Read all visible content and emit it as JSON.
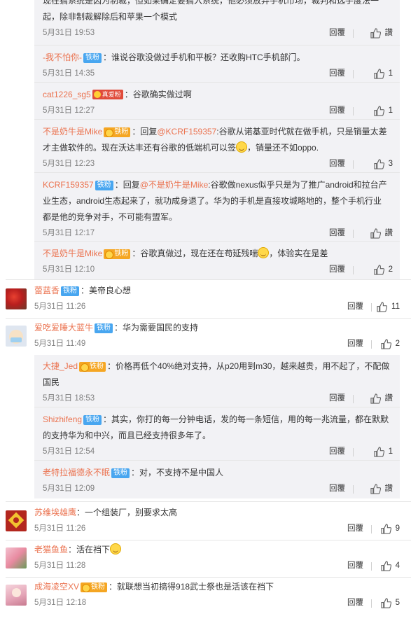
{
  "labels": {
    "reply": "回覆",
    "like": "讚"
  },
  "replies_a": [
    {
      "lines": [
        "现在搞系统是因为制裁，但如果确定要搞入系统，他必须放弃手机市场，裁判和选手度法一",
        "起，除非制裁解除后和苹果一个模式"
      ],
      "time": "5月31日 19:53",
      "likes": "讚"
    },
    {
      "user": "-我不怕你-",
      "badge": "铁粉",
      "text": "：谁说谷歌没做过手机和平板？还收购HTC手机部门。",
      "time": "5月31日 14:35",
      "likes": "1"
    },
    {
      "user": "cat1226_sg5",
      "badge": "真爱粉",
      "text": "：谷歌确实做过啊",
      "time": "5月31日 12:27",
      "likes": "1"
    },
    {
      "user": "不是奶牛是Mike",
      "badge": "铁粉",
      "reply_prefix": "：回复",
      "at": "@KCRF159357",
      "line1_rest": ":谷歌从诺基亚时代就在做手机，只是销量太差",
      "line2_a": "才主做软件的。现在沃达丰还有谷歌的低端机可以签",
      "line2_b": "，销量还不如oppo.",
      "time": "5月31日 12:23",
      "likes": "3"
    },
    {
      "user": "KCRF159357",
      "badge": "铁粉",
      "reply_prefix": "：回复",
      "at": "@不是奶牛是Mike",
      "line1_rest": ":谷歌做nexus似乎只是为了推广android和拉台产",
      "line2": "业生态，android生态起来了，就功成身退了。华为的手机是直接攻城略地的，整个手机行业",
      "line3": "都是他的竞争对手，不可能有盟军。",
      "time": "5月31日 12:17",
      "likes": "讚"
    },
    {
      "user": "不是奶牛是Mike",
      "badge": "铁粉",
      "text_a": "：谷歌真做过，现在还在苟延残喘",
      "text_b": "，体验实在是差",
      "time": "5月31日 12:10",
      "likes": "2"
    }
  ],
  "comments": [
    {
      "user": "蕾蓝香",
      "badge": "铁粉",
      "text": "：美帝良心想",
      "time": "5月31日 11:26",
      "likes": "11"
    },
    {
      "user": "爱吃爱睡大蓝牛",
      "badge": "铁粉",
      "text": "：华为需要国民的支持",
      "time": "5月31日 11:49",
      "likes": "2"
    }
  ],
  "replies_b": [
    {
      "user": "大捷_Jed",
      "badge": "铁粉",
      "line1": "：价格再低个40%绝对支持，从p20用到m30，越来越贵，用不起了，不配做",
      "line2": "国民",
      "time": "5月31日 18:53",
      "likes": "讚"
    },
    {
      "user": "Shizhifeng",
      "badge": "铁粉",
      "line1": "：其实，你打的每一分钟电话，发的每一条短信，用的每一兆流量，都在默默",
      "line2": "的支持华为和中兴，而且已经支持很多年了。",
      "time": "5月31日 12:54",
      "likes": "1"
    },
    {
      "user": "老特拉福德永不眠",
      "badge": "铁粉",
      "text": "：对，不支持不是中国人",
      "time": "5月31日 12:09",
      "likes": "讚"
    }
  ],
  "comments_b": [
    {
      "user": "苏维埃雄鹰",
      "text": "：一个组装厂，别要求太高",
      "time": "5月31日 11:26",
      "likes": "9"
    },
    {
      "user": "老猫鱼鱼",
      "text_a": "：活在裆下",
      "time": "5月31日 11:28",
      "likes": "4"
    },
    {
      "user": "成海凌空XV",
      "badge": "铁粉",
      "text": "：就联想当初搞得918武士祭也是活该在裆下",
      "time": "5月31日 12:18",
      "likes": "5"
    }
  ]
}
